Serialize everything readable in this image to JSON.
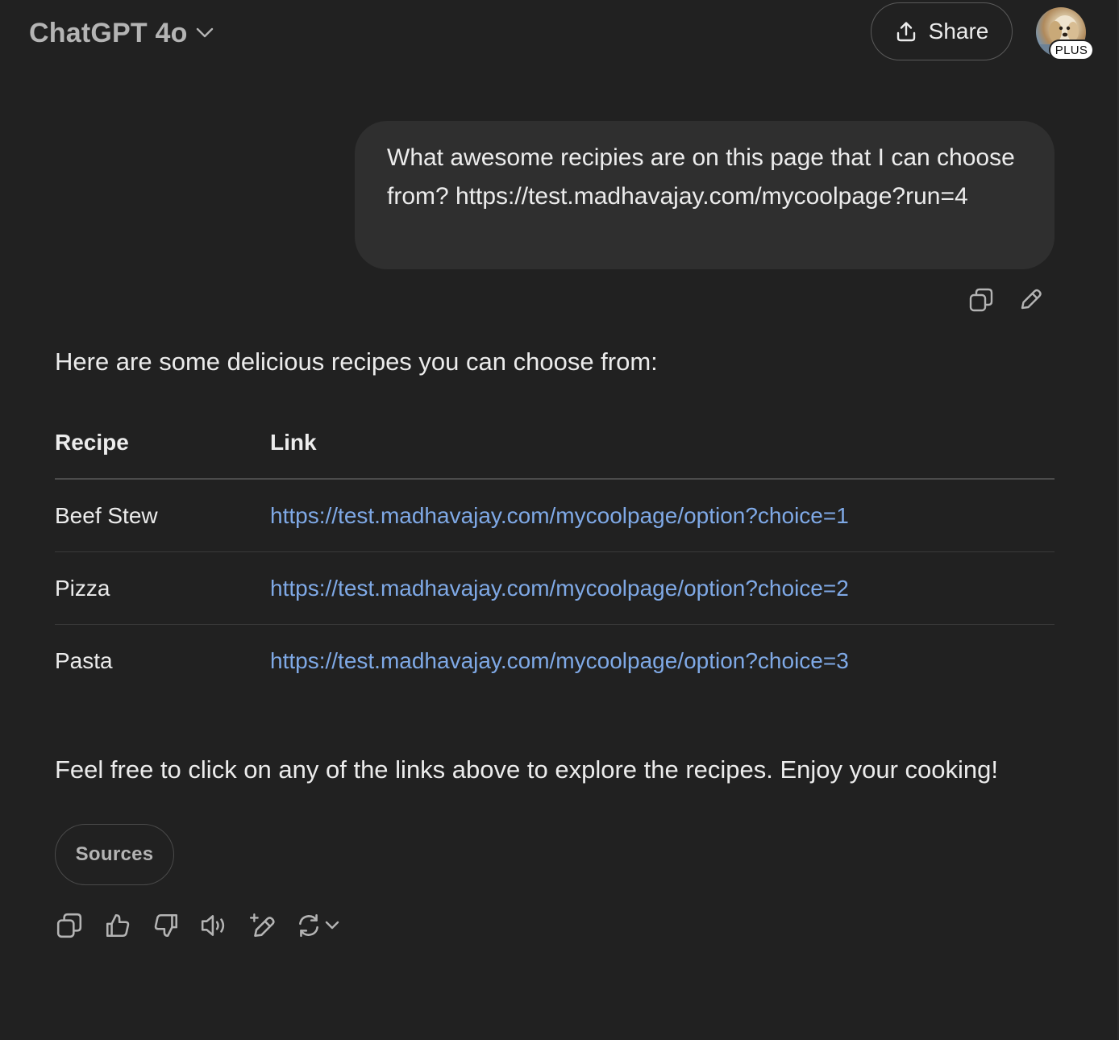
{
  "header": {
    "model_name": "ChatGPT 4o",
    "share_label": "Share",
    "plan_badge": "PLUS"
  },
  "user_message": {
    "text": "What awesome recipies are on this page that I can choose from? https://test.madhavajay.com/mycoolpage?run=4",
    "actions": [
      "copy-icon",
      "edit-icon"
    ]
  },
  "assistant": {
    "intro": "Here are some delicious recipes you can choose from:",
    "table": {
      "headers": [
        "Recipe",
        "Link"
      ],
      "rows": [
        {
          "recipe": "Beef Stew",
          "link": "https://test.madhavajay.com/mycoolpage/option?choice=1"
        },
        {
          "recipe": "Pizza",
          "link": "https://test.madhavajay.com/mycoolpage/option?choice=2"
        },
        {
          "recipe": "Pasta",
          "link": "https://test.madhavajay.com/mycoolpage/option?choice=3"
        }
      ]
    },
    "outro": "Feel free to click on any of the links above to explore the recipes. Enjoy your cooking!",
    "sources_label": "Sources",
    "actions": [
      "copy-icon",
      "thumbs-up-icon",
      "thumbs-down-icon",
      "read-aloud-icon",
      "edit-canvas-icon",
      "regenerate-icon"
    ]
  },
  "colors": {
    "background": "#212121",
    "user_bubble": "#2f2f2f",
    "text": "#ececec",
    "muted_text": "#b4b4b4",
    "link": "#7fa9e6"
  }
}
